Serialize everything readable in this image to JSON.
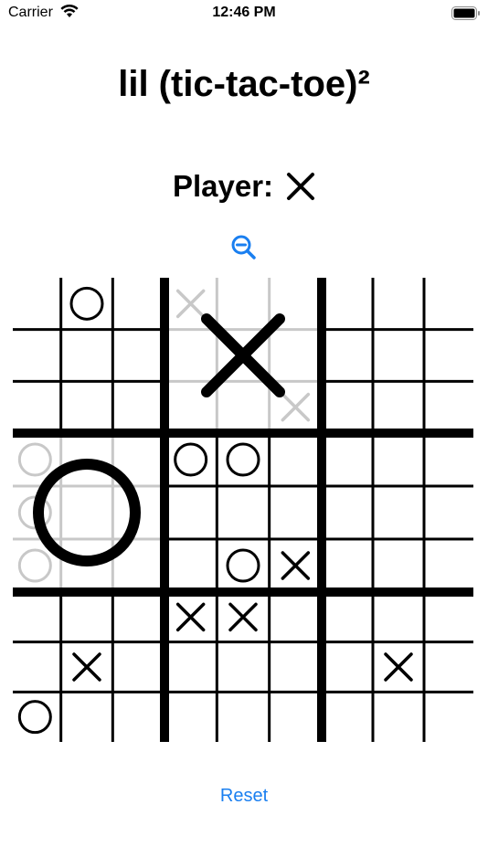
{
  "status_bar": {
    "carrier": "Carrier",
    "time": "12:46 PM"
  },
  "title": "lil (tic-tac-toe)²",
  "player": {
    "label": "Player:",
    "current_mark": "X"
  },
  "zoom_icon": "zoom-out-icon",
  "reset_label": "Reset",
  "colors": {
    "accent": "#1a7ff0",
    "dim": "#c8c8c8",
    "line": "#000000"
  },
  "board": {
    "big_cells": [
      {
        "row": 0,
        "col": 1,
        "winner": "X"
      },
      {
        "row": 1,
        "col": 0,
        "winner": "O"
      }
    ],
    "marks": [
      {
        "row": 0,
        "col": 1,
        "mark": "O"
      },
      {
        "row": 0,
        "col": 3,
        "mark": "X"
      },
      {
        "row": 2,
        "col": 5,
        "mark": "X"
      },
      {
        "row": 3,
        "col": 0,
        "mark": "O"
      },
      {
        "row": 3,
        "col": 3,
        "mark": "O"
      },
      {
        "row": 3,
        "col": 4,
        "mark": "O"
      },
      {
        "row": 4,
        "col": 0,
        "mark": "O"
      },
      {
        "row": 5,
        "col": 0,
        "mark": "O"
      },
      {
        "row": 5,
        "col": 4,
        "mark": "O"
      },
      {
        "row": 5,
        "col": 5,
        "mark": "X"
      },
      {
        "row": 6,
        "col": 3,
        "mark": "X"
      },
      {
        "row": 6,
        "col": 4,
        "mark": "X"
      },
      {
        "row": 7,
        "col": 1,
        "mark": "X"
      },
      {
        "row": 7,
        "col": 7,
        "mark": "X"
      },
      {
        "row": 8,
        "col": 0,
        "mark": "O"
      }
    ]
  }
}
